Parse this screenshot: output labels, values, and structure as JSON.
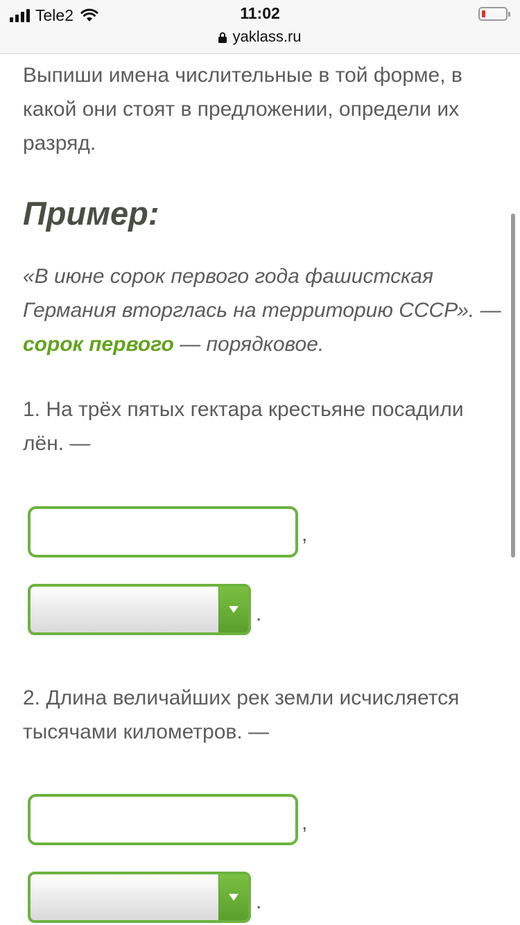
{
  "status_bar": {
    "carrier": "Tele2",
    "time": "11:02",
    "url": "yaklass.ru"
  },
  "task": {
    "instruction": "Выпиши имена числительные в той форме, в какой они стоят в предложении, определи их разряд.",
    "example_heading": "Пример:",
    "example_sentence": "«В июне сорок первого года фашистская Германия вторглась на территорию СССР». —",
    "example_highlight": "сорок первого",
    "example_suffix": "— порядковое."
  },
  "questions": [
    {
      "text": "1. На трёх пятых гектара крестьяне посадили лён. —",
      "input_value": "",
      "comma": ",",
      "select_value": "",
      "period": "."
    },
    {
      "text": "2. Длина величайших рек земли исчисляется тысячами километров. —",
      "input_value": "",
      "comma": ",",
      "select_value": "",
      "period": "."
    }
  ],
  "icons": {
    "signal": "cellular-signal-icon",
    "wifi": "wifi-icon",
    "battery": "battery-low-icon",
    "lock": "lock-icon",
    "dropdown": "dropdown-arrow-icon"
  },
  "colors": {
    "accent_green": "#6db33f",
    "highlight_green": "#62a31f",
    "battery_low": "#e0332c"
  }
}
